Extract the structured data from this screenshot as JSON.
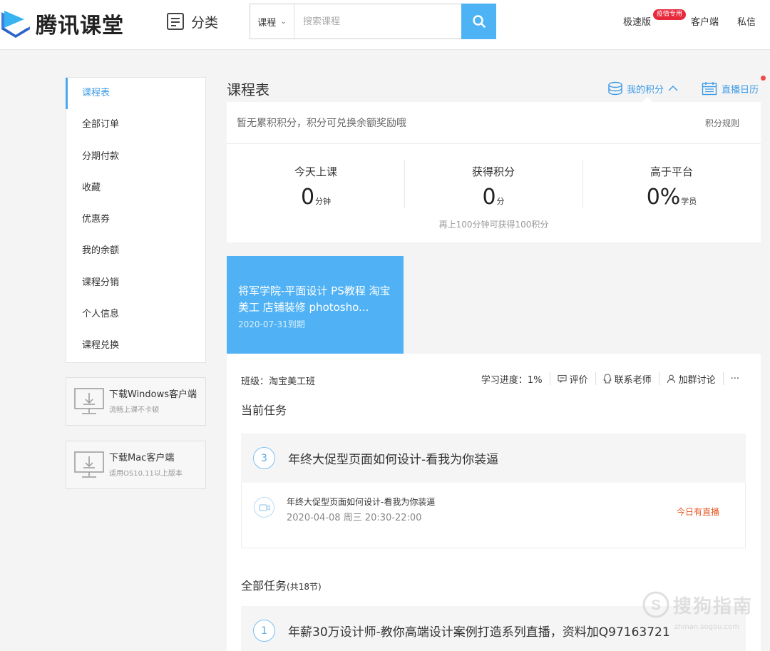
{
  "header": {
    "logo_text": "腾讯课堂",
    "category_label": "分类",
    "search": {
      "type_label": "课程",
      "placeholder": "搜索课程"
    },
    "speed_label": "极速版",
    "speed_badge": "疫情专用",
    "client_label": "客户端",
    "message_label": "私信"
  },
  "sidebar": {
    "items": [
      {
        "label": "课程表",
        "active": true
      },
      {
        "label": "全部订单"
      },
      {
        "label": "分期付款"
      },
      {
        "label": "收藏"
      },
      {
        "label": "优惠券"
      },
      {
        "label": "我的余额"
      },
      {
        "label": "课程分销"
      },
      {
        "label": "个人信息"
      },
      {
        "label": "课程兑换"
      }
    ],
    "downloads": [
      {
        "title": "下载Windows客户端",
        "subtitle": "流畅上课不卡顿"
      },
      {
        "title": "下载Mac客户端",
        "subtitle": "适用OS10.11以上版本"
      }
    ]
  },
  "main": {
    "title": "课程表",
    "points_link": "我的积分",
    "live_calendar": "直播日历",
    "points": {
      "note": "暂无累积积分，积分可兑换余额奖励哦",
      "rule_link": "积分规则",
      "stats": [
        {
          "label": "今天上课",
          "value": "0",
          "unit": "分钟"
        },
        {
          "label": "获得积分",
          "value": "0",
          "unit": "分"
        },
        {
          "label": "高于平台",
          "value": "0%",
          "unit": "学员"
        }
      ],
      "hint": "再上100分钟可获得100积分"
    },
    "course": {
      "name": "将军学院-平面设计 PS教程 淘宝美工 店铺装修 photosho...",
      "expire": "2020-07-31到期",
      "class_label": "班级：淘宝美工班",
      "progress": "学习进度：1%",
      "review": "评价",
      "contact": "联系老师",
      "join_group": "加群讨论",
      "more": "···",
      "current_task_title": "当前任务",
      "current_task": {
        "num": "3",
        "title": "年终大促型页面如何设计-看我为你装逼",
        "session_title": "年终大促型页面如何设计-看我为你装逼",
        "session_time": "2020-04-08 周三 20:30-22:00",
        "live_status": "今日有直播"
      },
      "all_tasks_title": "全部任务",
      "all_tasks_count": "(共18节)",
      "first_task": {
        "num": "1",
        "title": "年薪30万设计师-教你高端设计案例打造系列直播，资料加Q97163721"
      }
    }
  },
  "watermark": {
    "text": "搜狗指南",
    "url": "zhinan.sogou.com"
  },
  "colors": {
    "accent": "#4db3f5",
    "active_nav": "#3b9ae6",
    "live": "#e8541e",
    "badge": "#e8283b"
  }
}
